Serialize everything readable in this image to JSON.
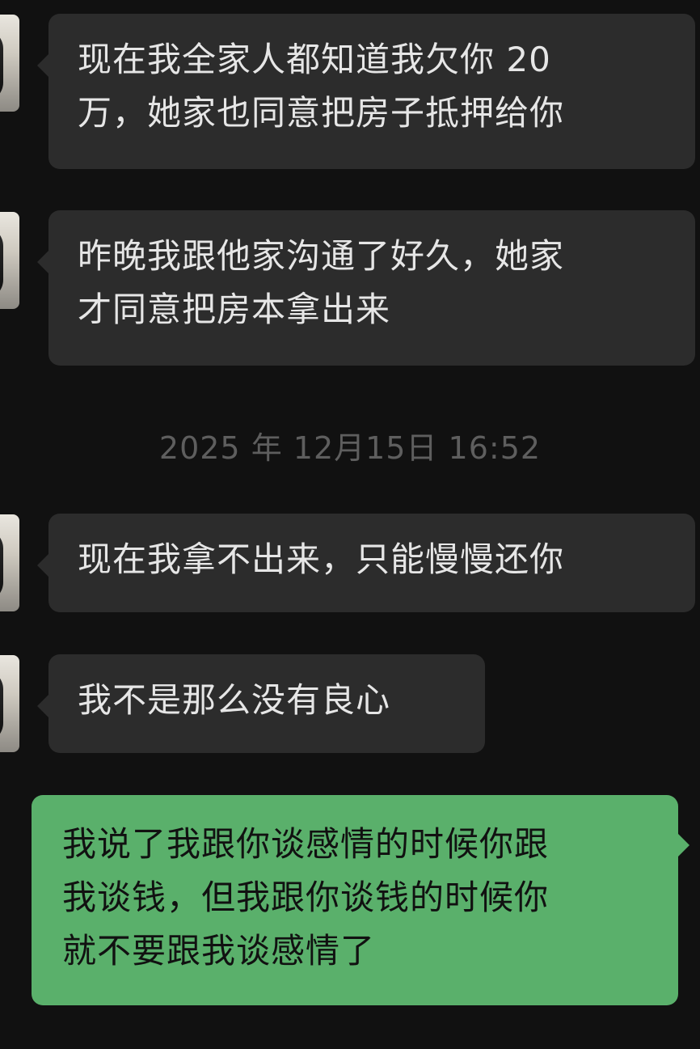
{
  "chat": {
    "messages": [
      {
        "sender": "other",
        "lines": [
          "现在我全家人都知道我欠你 20",
          "万，她家也同意把房子抵押给你"
        ]
      },
      {
        "sender": "other",
        "lines": [
          "昨晚我跟他家沟通了好久，她家",
          "才同意把房本拿出来"
        ]
      },
      {
        "sender": "other",
        "lines": [
          "现在我拿不出来，只能慢慢还你"
        ]
      },
      {
        "sender": "other",
        "lines": [
          "我不是那么没有良心"
        ]
      },
      {
        "sender": "self",
        "lines": [
          "我说了我跟你谈感情的时候你跟",
          "我谈钱，但我跟你谈钱的时候你",
          "就不要跟我谈感情了"
        ]
      }
    ],
    "timestamp": "2025 年 12月15日 16:52"
  },
  "colors": {
    "background": "#111111",
    "incoming_bubble": "#2c2c2c",
    "outgoing_bubble": "#5ab06b",
    "timestamp_text": "#5e5e5e"
  }
}
